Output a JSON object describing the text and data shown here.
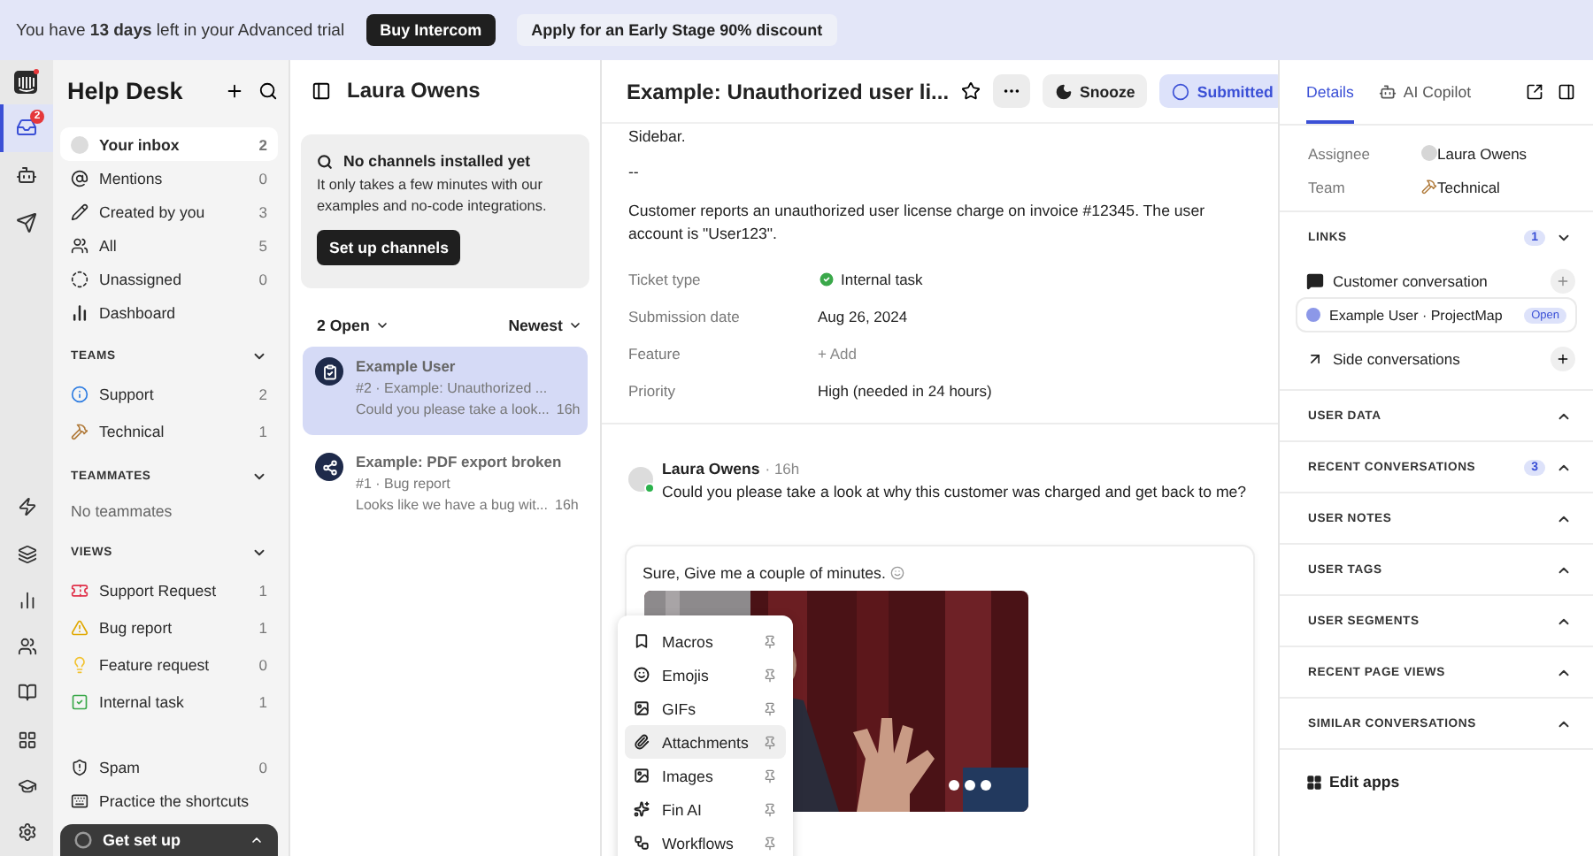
{
  "banner": {
    "text": "You have **13 days** left in your Advanced trial",
    "buttons": [
      {
        "label": "Buy Intercom",
        "kind": "primary"
      },
      {
        "label": "Apply for an Early Stage 90% discount",
        "kind": "secondary"
      }
    ]
  },
  "rail": {
    "top": [
      {
        "selected": true,
        "badge": "2"
      },
      {
        "selected": false
      },
      {
        "selected": false
      }
    ],
    "bottom": [
      {
        "selected": false
      },
      {
        "selected": false
      },
      {
        "selected": false
      },
      {
        "selected": false
      },
      {
        "selected": false
      },
      {
        "selected": false
      },
      {
        "selected": false
      },
      {
        "selected": false
      }
    ]
  },
  "sidebar": {
    "title": "Help Desk",
    "inbox": [
      {
        "label": "Your inbox",
        "count": "2",
        "selected": true
      },
      {
        "label": "Mentions",
        "count": "0",
        "selected": false
      },
      {
        "label": "Created by you",
        "count": "3",
        "selected": false
      },
      {
        "label": "All",
        "count": "5",
        "selected": false
      },
      {
        "label": "Unassigned",
        "count": "0",
        "selected": false
      },
      {
        "label": "Dashboard",
        "selected": false
      }
    ],
    "sections": [
      {
        "title": "TEAMS",
        "expanded": true,
        "items": [
          {
            "label": "Support",
            "count": "2",
            "selected": false
          },
          {
            "label": "Technical",
            "count": "1",
            "selected": false
          }
        ]
      },
      {
        "title": "TEAMMATES",
        "expanded": true,
        "empty": "No teammates"
      },
      {
        "title": "VIEWS",
        "expanded": true,
        "items": [
          {
            "label": "Support Request",
            "count": "1",
            "selected": false
          },
          {
            "label": "Bug report",
            "count": "1",
            "selected": false
          },
          {
            "label": "Feature request",
            "count": "0",
            "selected": false
          },
          {
            "label": "Internal task",
            "count": "1",
            "selected": false
          }
        ]
      }
    ],
    "footer": [
      {
        "label": "Spam",
        "count": "0",
        "selected": false
      },
      {
        "label": "Practice the shortcuts",
        "selected": false
      }
    ],
    "setup": {
      "label": "Get set up",
      "expanded": false
    }
  },
  "inbox_list": {
    "title": "Laura Owens",
    "notice": {
      "title": "No channels installed yet",
      "text": "It only takes a few minutes with our examples and no-code integrations.",
      "button": "Set up channels"
    },
    "filters": [
      {
        "label": "2 Open"
      },
      {
        "label": "Newest"
      }
    ],
    "conversations": [
      {
        "title": "Example User",
        "subtitle": "#2 · Example: Unauthorized ...",
        "preview": "Could you please take a look...",
        "time": "16h",
        "selected": true
      },
      {
        "title": "Example: PDF export broken",
        "subtitle": "#1 · Bug report",
        "preview": "Looks like we have a bug wit...",
        "time": "16h",
        "selected": false
      }
    ]
  },
  "conversation": {
    "title": "Example: Unauthorized user li...",
    "actions": [
      {
        "label": "Snooze",
        "kind": "snooze"
      },
      {
        "label": "Submitted",
        "kind": "status"
      }
    ],
    "body": [
      "Sidebar.",
      "--",
      "Customer reports an unauthorized user license charge on invoice #12345. The user account is \"User123\"."
    ],
    "attributes": [
      {
        "label": "Ticket type",
        "value": "Internal task",
        "kind": "ticket-type"
      },
      {
        "label": "Submission date",
        "value": "Aug 26, 2024",
        "kind": "text"
      },
      {
        "label": "Feature",
        "value": "+ Add",
        "kind": "empty"
      },
      {
        "label": "Priority",
        "value": "High (needed in 24 hours)",
        "kind": "text"
      }
    ],
    "message": {
      "author": "Laura Owens",
      "time": "· 16h",
      "online": true,
      "text": "Could you please take a look at why this customer was charged and get back to me?"
    },
    "composer": {
      "text": "Sure, Give me a couple of minutes."
    },
    "menu": [
      {
        "label": "Macros",
        "selected": false
      },
      {
        "label": "Emojis",
        "selected": false
      },
      {
        "label": "GIFs",
        "selected": false
      },
      {
        "label": "Attachments",
        "selected": true
      },
      {
        "label": "Images",
        "selected": false
      },
      {
        "label": "Fin AI",
        "selected": false
      },
      {
        "label": "Workflows",
        "selected": false
      }
    ]
  },
  "details": {
    "tabs": [
      {
        "label": "Details",
        "selected": true
      },
      {
        "label": "AI Copilot",
        "selected": false
      }
    ],
    "fields": [
      {
        "label": "Assignee",
        "value": "Laura Owens",
        "kind": "person"
      },
      {
        "label": "Team",
        "value": "Technical",
        "kind": "team"
      }
    ],
    "links": {
      "title": "LINKS",
      "count": "1",
      "expanded": true,
      "customer_conversation": "Customer conversation",
      "linked": {
        "title": "Example User · ProjectMap",
        "status": "Open"
      },
      "side_conversations": "Side conversations"
    },
    "sections": [
      {
        "title": "USER DATA",
        "expanded": false
      },
      {
        "title": "RECENT CONVERSATIONS",
        "count": "3",
        "expanded": false
      },
      {
        "title": "USER NOTES",
        "expanded": false
      },
      {
        "title": "USER TAGS",
        "expanded": false
      },
      {
        "title": "USER SEGMENTS",
        "expanded": false
      },
      {
        "title": "RECENT PAGE VIEWS",
        "expanded": false
      },
      {
        "title": "SIMILAR CONVERSATIONS",
        "expanded": false
      }
    ],
    "edit_apps": "Edit apps"
  }
}
